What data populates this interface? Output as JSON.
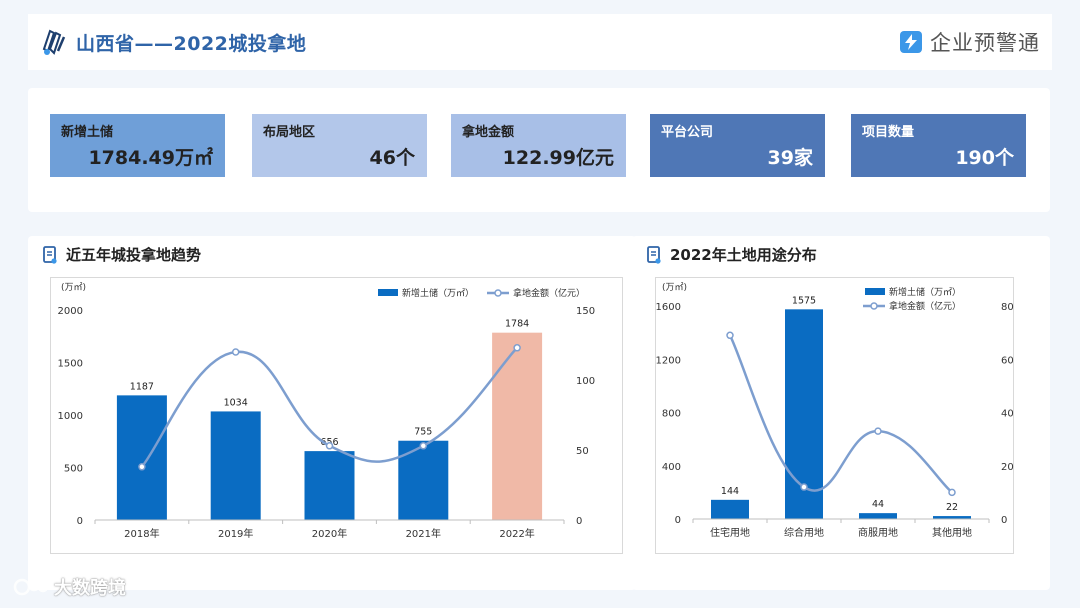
{
  "header": {
    "title": "山西省——2022城投拿地",
    "brand_name": "企业预警通"
  },
  "kpis": [
    {
      "label": "新增土储",
      "value": "1784.49万㎡",
      "color": "#6f9fd8"
    },
    {
      "label": "布局地区",
      "value": "46个",
      "color": "#b3c7ea"
    },
    {
      "label": "拿地金额",
      "value": "122.99亿元",
      "color": "#a8bfe7"
    },
    {
      "label": "平台公司",
      "value": "39家",
      "color": "#4f77b6"
    },
    {
      "label": "项目数量",
      "value": "190个",
      "color": "#4f77b6"
    }
  ],
  "sections": {
    "trend_title": "近五年城投拿地趋势",
    "usage_title": "2022年土地用途分布"
  },
  "watermark": "大数跨境",
  "colors": {
    "bar": "#0a6cc2",
    "highlight_bar": "#f0b9a7",
    "line": "#7d9ecf"
  },
  "chart_data": [
    {
      "type": "bar",
      "categories": [
        "2018年",
        "2019年",
        "2020年",
        "2021年",
        "2022年"
      ],
      "series": [
        {
          "name": "新增土储（万㎡）",
          "axis": "left",
          "type": "bar",
          "values": [
            1187,
            1034,
            656,
            755,
            1784
          ]
        },
        {
          "name": "拿地金额（亿元）",
          "axis": "right",
          "type": "line",
          "values": [
            38,
            120,
            53,
            53,
            123
          ]
        }
      ],
      "y_unit_label": "(万㎡)",
      "ylim": [
        0,
        2000
      ],
      "yticks": [
        "0",
        "500",
        "1000",
        "1500",
        "2000"
      ],
      "y2lim": [
        0,
        150
      ],
      "y2ticks": [
        "0",
        "50",
        "100",
        "150"
      ],
      "highlight_index": 4,
      "legend": "top-right",
      "grid": false
    },
    {
      "type": "bar",
      "categories": [
        "住宅用地",
        "综合用地",
        "商服用地",
        "其他用地"
      ],
      "series": [
        {
          "name": "新增土储（万㎡）",
          "axis": "left",
          "type": "bar",
          "values": [
            144,
            1575,
            44,
            22
          ]
        },
        {
          "name": "拿地金额（亿元）",
          "axis": "right",
          "type": "line",
          "values": [
            69,
            12,
            33,
            10
          ]
        }
      ],
      "y_unit_label": "(万㎡)",
      "ylim": [
        0,
        1600
      ],
      "yticks": [
        "0",
        "400",
        "800",
        "1200",
        "1600"
      ],
      "y2lim": [
        0,
        80
      ],
      "y2ticks": [
        "0",
        "20",
        "40",
        "60",
        "80"
      ],
      "legend": "top-right",
      "grid": false
    }
  ]
}
